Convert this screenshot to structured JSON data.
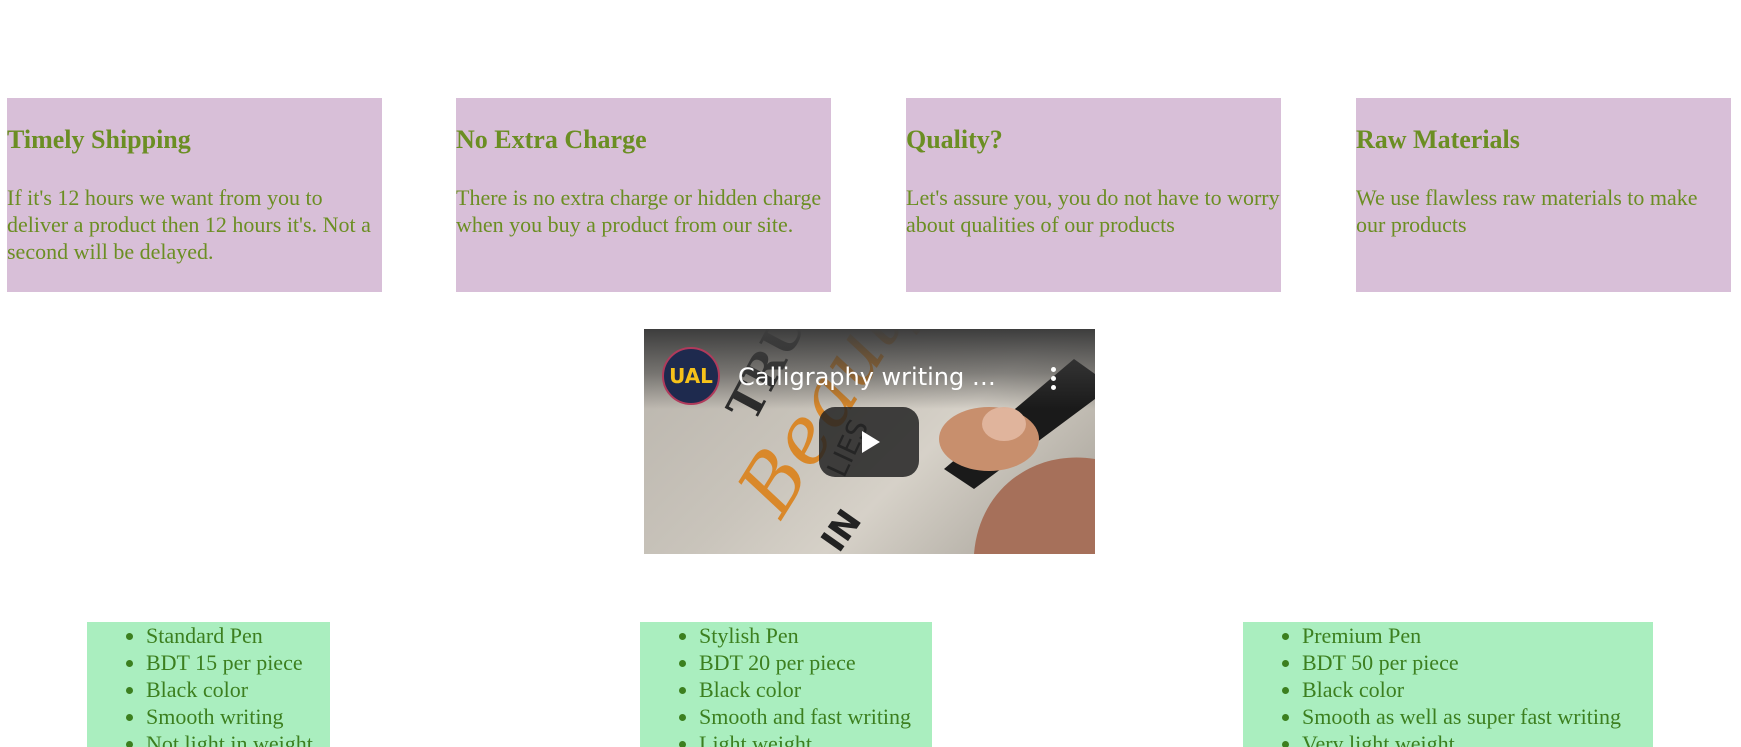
{
  "features": [
    {
      "title": "Timely Shipping",
      "text": "If it's 12 hours we want from you to deliver a product then 12 hours it's. Not a second will be delayed."
    },
    {
      "title": "No Extra Charge",
      "text": "There is no extra charge or hidden charge when you buy a product from our site."
    },
    {
      "title": "Quality?",
      "text": "Let's assure you, you do not have to worry about qualities of our products"
    },
    {
      "title": "Raw Materials",
      "text": "We use flawless raw materials to make our products"
    }
  ],
  "video": {
    "title": "Calligraphy writing H...",
    "channel_logo_text": "UAL",
    "play_icon": "play-icon",
    "menu_icon": "more-vert-icon"
  },
  "plans": [
    {
      "items": [
        "Standard Pen",
        "BDT 15 per piece",
        "Black color",
        "Smooth writing",
        "Not light in weight"
      ]
    },
    {
      "items": [
        "Stylish Pen",
        "BDT 20 per piece",
        "Black color",
        "Smooth and fast writing",
        "Light weight"
      ]
    },
    {
      "items": [
        "Premium Pen",
        "BDT 50 per piece",
        "Black color",
        "Smooth as well as super fast writing",
        "Very light weight"
      ]
    }
  ],
  "colors": {
    "feature_bg": "#d8bfd8",
    "feature_text": "#6b8e23",
    "plan_bg": "#aaeebf",
    "plan_text": "#3c7f1f"
  }
}
